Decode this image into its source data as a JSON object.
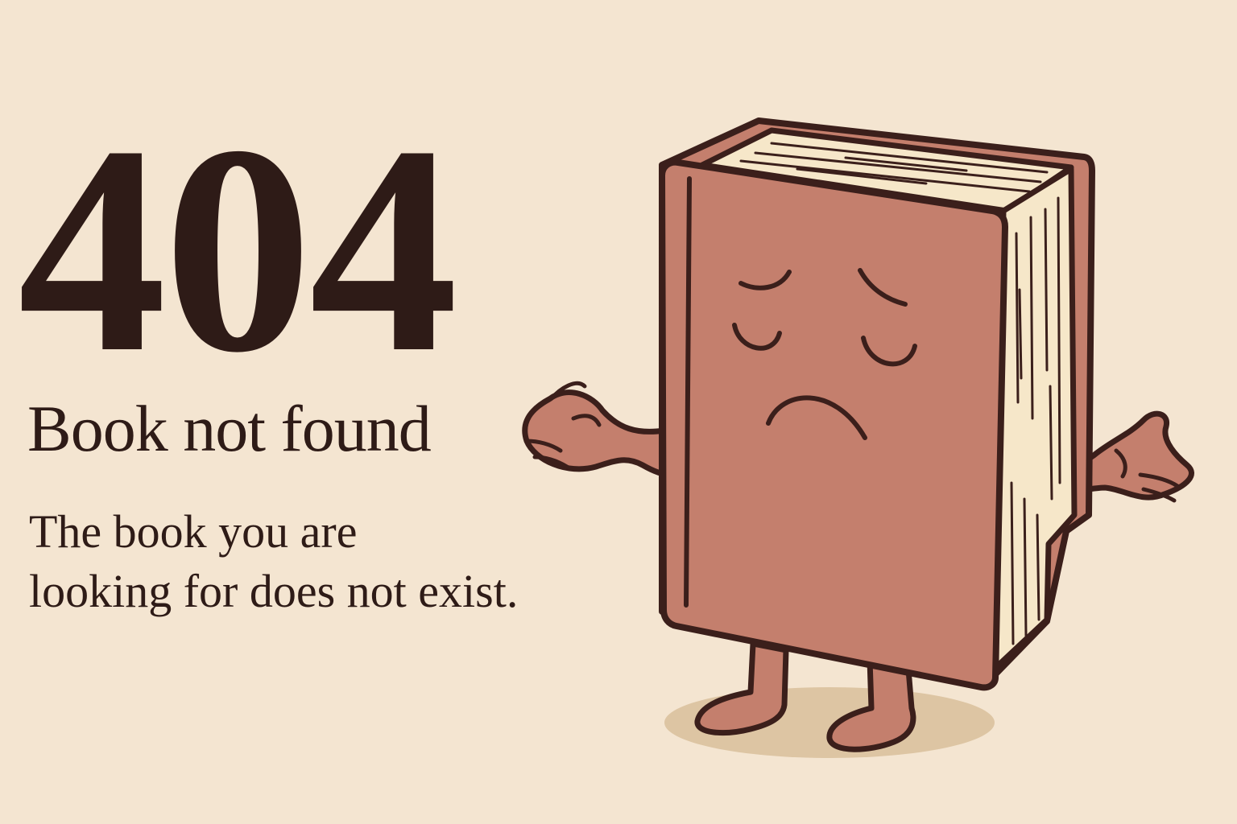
{
  "error": {
    "code": "404",
    "headline": "Book not found",
    "message_line1": "The book you are",
    "message_line2": "looking for does not exist."
  },
  "illustration": {
    "name": "sad-book-character",
    "colors": {
      "background": "#f4e5d1",
      "cover": "#c47f6d",
      "pages": "#f6e7c9",
      "outline": "#3b1f1b",
      "shadow": "#ddc5a3",
      "text": "#2e1b17"
    }
  }
}
